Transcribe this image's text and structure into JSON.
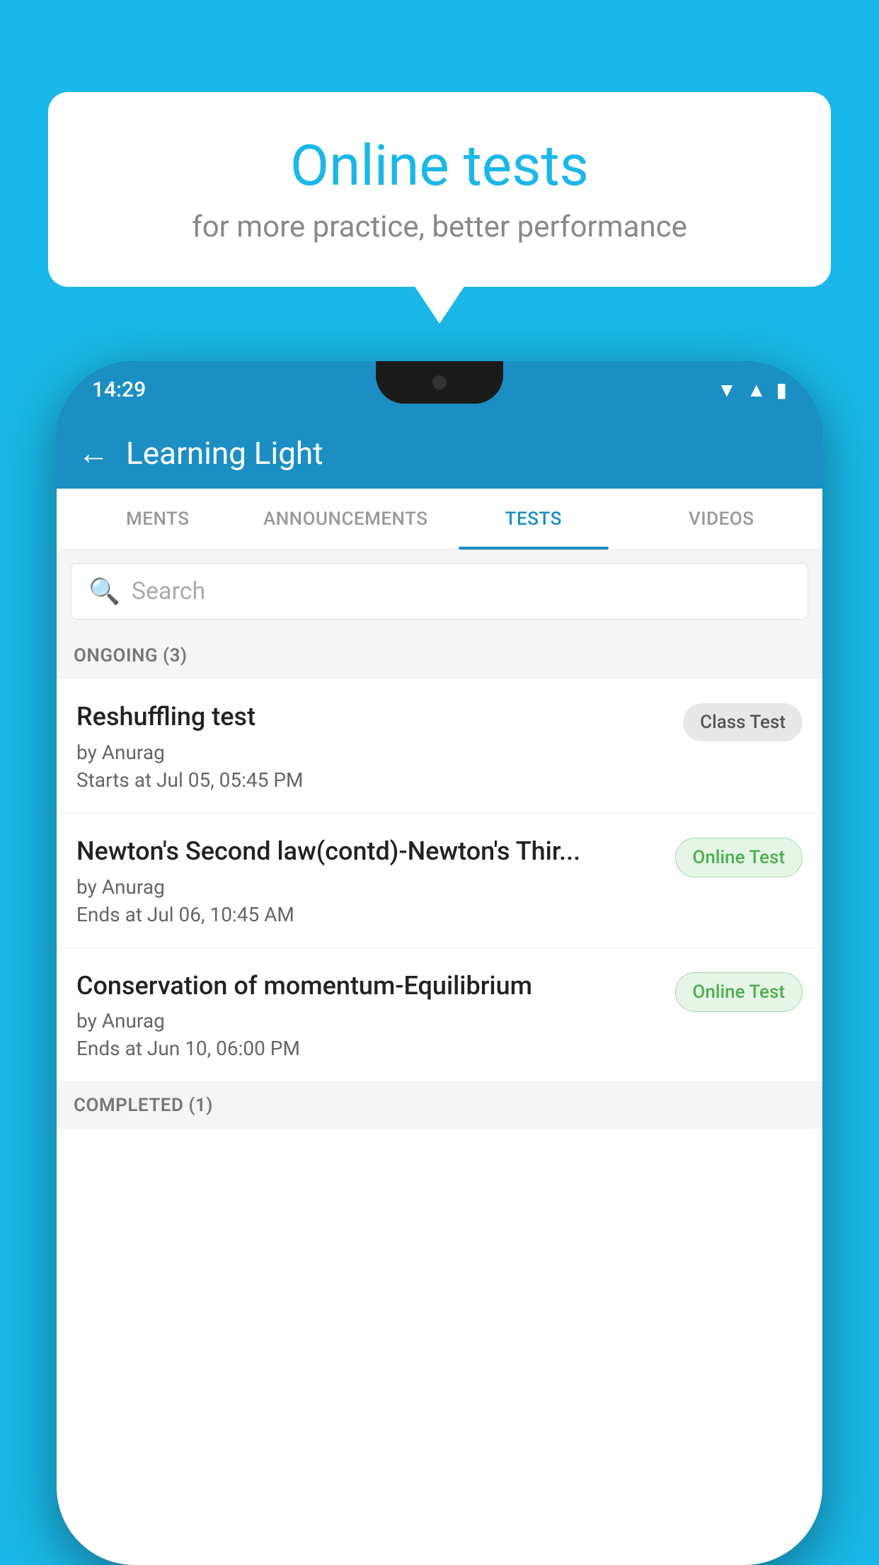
{
  "background_color": "#1ab8e8",
  "speech_bubble": {
    "title": "Online tests",
    "subtitle": "for more practice, better performance"
  },
  "phone": {
    "status_bar": {
      "time": "14:29",
      "icons": [
        "wifi",
        "signal",
        "battery"
      ]
    },
    "app_header": {
      "back_label": "←",
      "title": "Learning Light"
    },
    "tabs": [
      {
        "label": "MENTS",
        "active": false
      },
      {
        "label": "ANNOUNCEMENTS",
        "active": false
      },
      {
        "label": "TESTS",
        "active": true
      },
      {
        "label": "VIDEOS",
        "active": false
      }
    ],
    "search": {
      "placeholder": "Search",
      "icon": "🔍"
    },
    "sections": [
      {
        "header": "ONGOING (3)",
        "items": [
          {
            "name": "Reshuffling test",
            "author": "by Anurag",
            "time": "Starts at  Jul 05, 05:45 PM",
            "badge": "Class Test",
            "badge_type": "class"
          },
          {
            "name": "Newton's Second law(contd)-Newton's Thir...",
            "author": "by Anurag",
            "time": "Ends at  Jul 06, 10:45 AM",
            "badge": "Online Test",
            "badge_type": "online"
          },
          {
            "name": "Conservation of momentum-Equilibrium",
            "author": "by Anurag",
            "time": "Ends at  Jun 10, 06:00 PM",
            "badge": "Online Test",
            "badge_type": "online"
          }
        ]
      }
    ],
    "completed_header": "COMPLETED (1)"
  }
}
